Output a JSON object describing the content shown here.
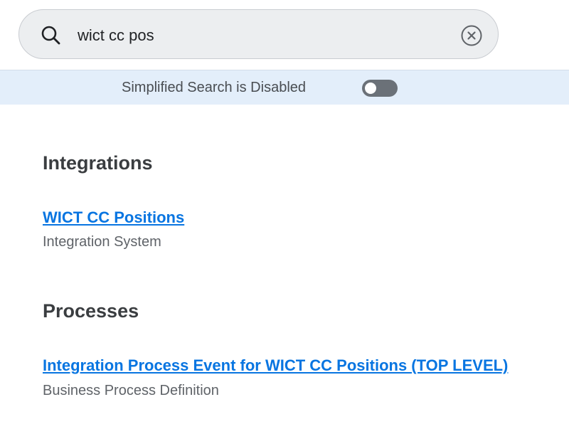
{
  "search": {
    "query": "wict cc pos",
    "search_icon": "search-icon",
    "clear_icon": "close-circle-icon"
  },
  "banner": {
    "label": "Simplified Search is Disabled",
    "toggle_state": "off"
  },
  "sections": [
    {
      "title": "Integrations",
      "results": [
        {
          "title": "WICT CC Positions",
          "subtitle": "Integration System"
        }
      ]
    },
    {
      "title": "Processes",
      "results": [
        {
          "title": "Integration Process Event for WICT CC Positions (TOP LEVEL)",
          "subtitle": "Business Process Definition"
        }
      ]
    }
  ],
  "colors": {
    "link": "#0875e1",
    "banner_bg": "#e3eefa",
    "search_bg": "#eceef0",
    "toggle_off": "#6b7178"
  }
}
